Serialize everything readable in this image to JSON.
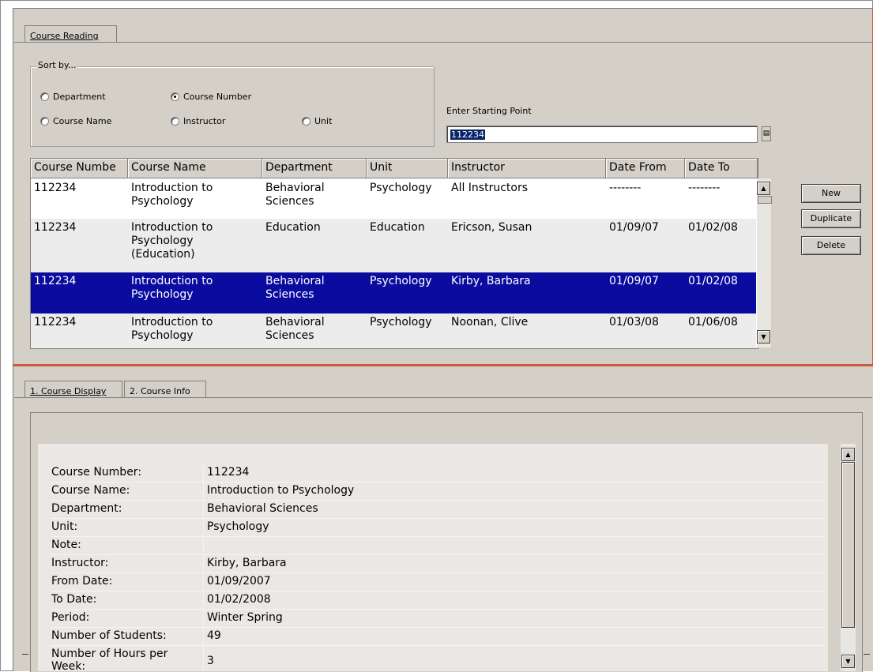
{
  "top_tabs": [
    {
      "label": "Course Reading"
    }
  ],
  "sort": {
    "title": "Sort by...",
    "options": [
      {
        "label": "Department",
        "selected": false
      },
      {
        "label": "Course Number",
        "selected": true
      },
      {
        "label": "Course Name",
        "selected": false
      },
      {
        "label": "Instructor",
        "selected": false
      },
      {
        "label": "Unit",
        "selected": false
      }
    ]
  },
  "search": {
    "label": "Enter Starting Point",
    "value": "112234"
  },
  "grid": {
    "columns": [
      "Course Numbe",
      "Course Name",
      "Department",
      "Unit",
      "Instructor",
      "Date From",
      "Date To"
    ],
    "rows": [
      {
        "number": "112234",
        "name": "Introduction to\nPsychology",
        "department": "Behavioral\nSciences",
        "unit": "Psychology",
        "instructor": "All Instructors",
        "date_from": "--------",
        "date_to": "--------",
        "selected": false
      },
      {
        "number": "112234",
        "name": "Introduction to\nPsychology\n(Education)",
        "department": "Education",
        "unit": "Education",
        "instructor": "Ericson, Susan",
        "date_from": "01/09/07",
        "date_to": "01/02/08",
        "selected": false
      },
      {
        "number": "112234",
        "name": "Introduction to\nPsychology",
        "department": "Behavioral\nSciences",
        "unit": "Psychology",
        "instructor": "Kirby, Barbara",
        "date_from": "01/09/07",
        "date_to": "01/02/08",
        "selected": true
      },
      {
        "number": "112234",
        "name": "Introduction to\nPsychology",
        "department": "Behavioral\nSciences",
        "unit": "Psychology",
        "instructor": "Noonan, Clive",
        "date_from": "01/03/08",
        "date_to": "01/06/08",
        "selected": false
      }
    ]
  },
  "buttons": {
    "new": "New",
    "duplicate": "Duplicate",
    "delete": "Delete"
  },
  "bottom_tabs": [
    {
      "label": "1. Course Display"
    },
    {
      "label": "2. Course Info"
    }
  ],
  "info": [
    {
      "key": "Course Number:",
      "value": "112234"
    },
    {
      "key": "Course Name:",
      "value": "Introduction to Psychology"
    },
    {
      "key": "Department:",
      "value": "Behavioral Sciences"
    },
    {
      "key": "Unit:",
      "value": "Psychology"
    },
    {
      "key": "Note:",
      "value": ""
    },
    {
      "key": "Instructor:",
      "value": "Kirby, Barbara"
    },
    {
      "key": "From Date:",
      "value": "01/09/2007"
    },
    {
      "key": "To Date:",
      "value": "01/02/2008"
    },
    {
      "key": "Period:",
      "value": "Winter Spring"
    },
    {
      "key": "Number of Students:",
      "value": "49"
    },
    {
      "key": "Number of Hours per Week:",
      "value": "3"
    }
  ],
  "colors": {
    "panel": "#d4d0c8",
    "selection": "#0a246a",
    "accent_border": "#c85a3c"
  }
}
